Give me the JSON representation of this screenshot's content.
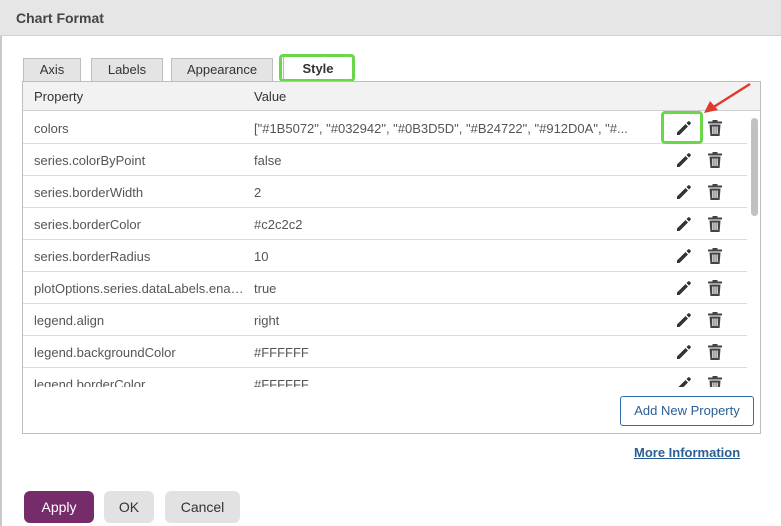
{
  "dialog": {
    "title": "Chart Format"
  },
  "tabs": [
    {
      "label": "Axis",
      "active": false
    },
    {
      "label": "Labels",
      "active": false
    },
    {
      "label": "Appearance",
      "active": false
    },
    {
      "label": "Style",
      "active": true
    }
  ],
  "table": {
    "headers": {
      "property": "Property",
      "value": "Value"
    },
    "rows": [
      {
        "property": "colors",
        "value": "[\"#1B5072\", \"#032942\", \"#0B3D5D\", \"#B24722\", \"#912D0A\", \"#..."
      },
      {
        "property": "series.colorByPoint",
        "value": "false"
      },
      {
        "property": "series.borderWidth",
        "value": "2"
      },
      {
        "property": "series.borderColor",
        "value": "#c2c2c2"
      },
      {
        "property": "series.borderRadius",
        "value": "10"
      },
      {
        "property": "plotOptions.series.dataLabels.enabled",
        "value": "true"
      },
      {
        "property": "legend.align",
        "value": "right"
      },
      {
        "property": "legend.backgroundColor",
        "value": "#FFFFFF"
      },
      {
        "property": "legend.borderColor",
        "value": "#FFFFFF"
      }
    ],
    "row_icons": {
      "edit": "pencil-icon",
      "delete": "trash-icon"
    }
  },
  "add_property_label": "Add New Property",
  "more_information_label": "More Information",
  "footer": {
    "apply": "Apply",
    "ok": "OK",
    "cancel": "Cancel"
  },
  "colors": {
    "highlight": "#6cd64a",
    "apply": "#762c6b",
    "link": "#2b5f94",
    "arrow": "#e03a2f"
  }
}
